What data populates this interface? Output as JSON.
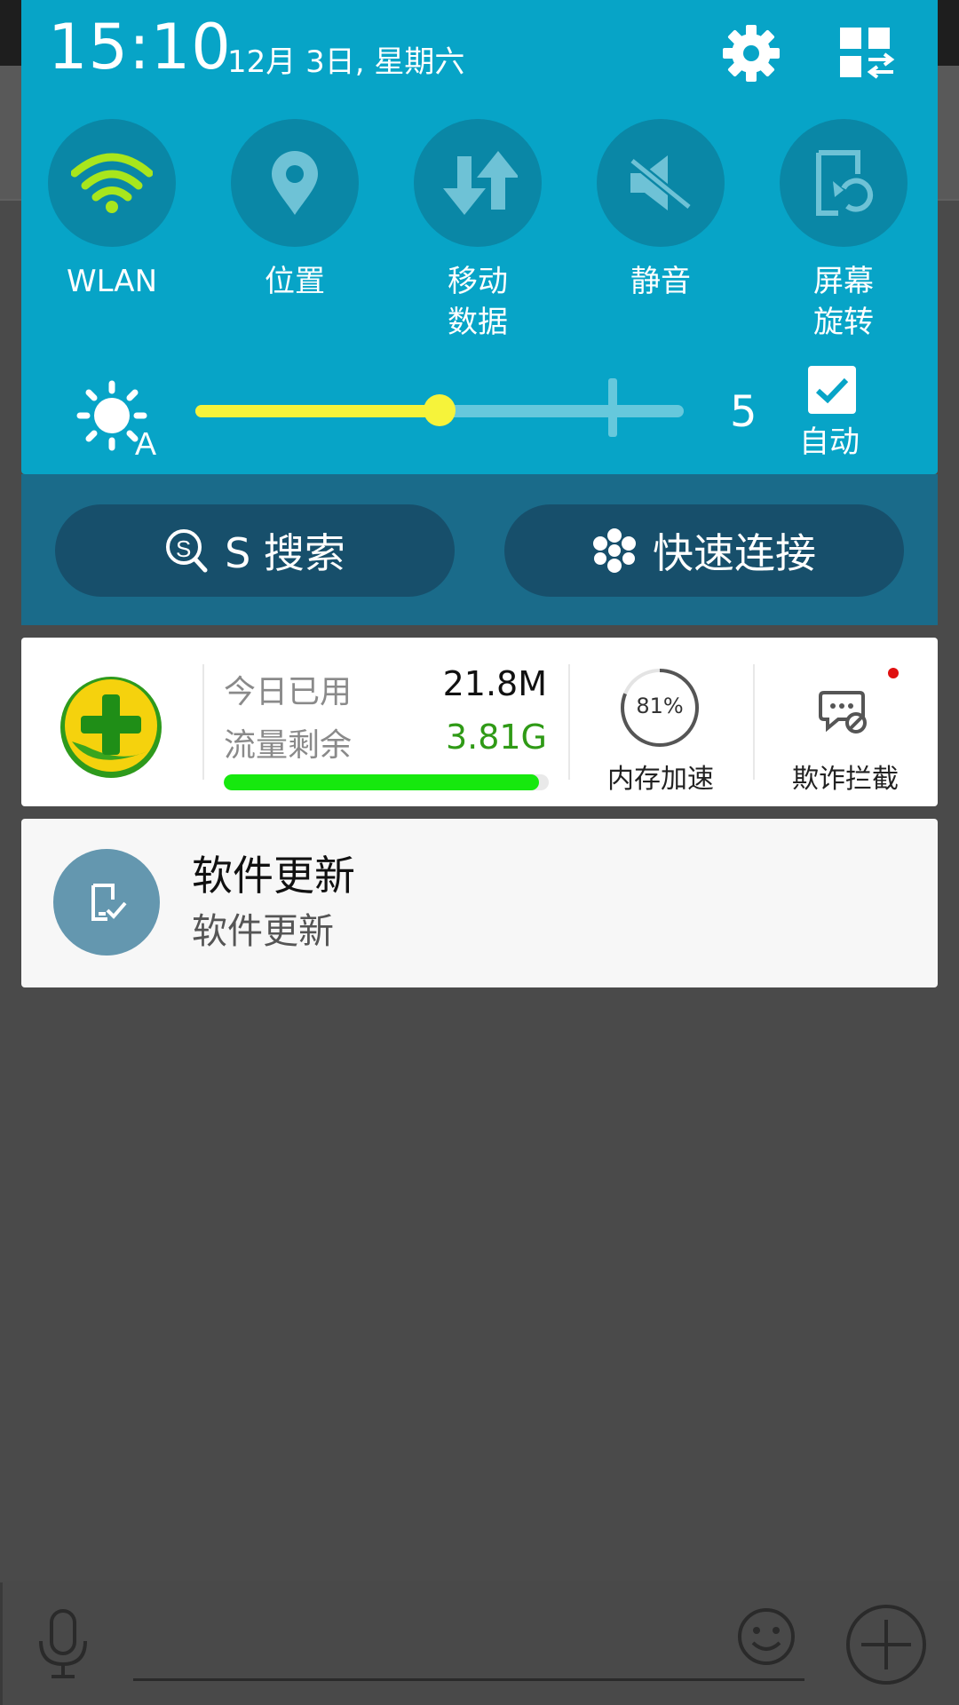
{
  "quick_panel": {
    "time": "15:10",
    "date": "12月 3日, 星期六",
    "toggles": [
      {
        "label": "WLAN",
        "icon": "wifi-icon",
        "active": true
      },
      {
        "label": "位置",
        "icon": "location-icon",
        "active": false
      },
      {
        "label": "移动\n数据",
        "icon": "mobile-data-icon",
        "active": false
      },
      {
        "label": "静音",
        "icon": "mute-icon",
        "active": false
      },
      {
        "label": "屏幕\n旋转",
        "icon": "screen-rotation-icon",
        "active": false
      }
    ],
    "brightness": {
      "value": "5",
      "level_fraction": 0.5,
      "auto_label": "自动",
      "auto_checked": true
    },
    "search_button": "S 搜索",
    "quick_connect_button": "快速连接"
  },
  "notification_360": {
    "used_label": "今日已用",
    "used_value": "21.8M",
    "remaining_label": "流量剩余",
    "remaining_value": "3.81G",
    "remaining_fraction": 0.97,
    "memory_percent": "81%",
    "memory_fraction": 0.81,
    "memory_label": "内存加速",
    "fraud_label": "欺诈拦截"
  },
  "notification_update": {
    "title": "软件更新",
    "text": "软件更新"
  },
  "colors": {
    "panel": "#07a4c7",
    "toggle_bg": "#0a87a6",
    "wifi_active": "#a8e61d",
    "slider": "#f6f33a",
    "green_value": "#2f9a16"
  }
}
